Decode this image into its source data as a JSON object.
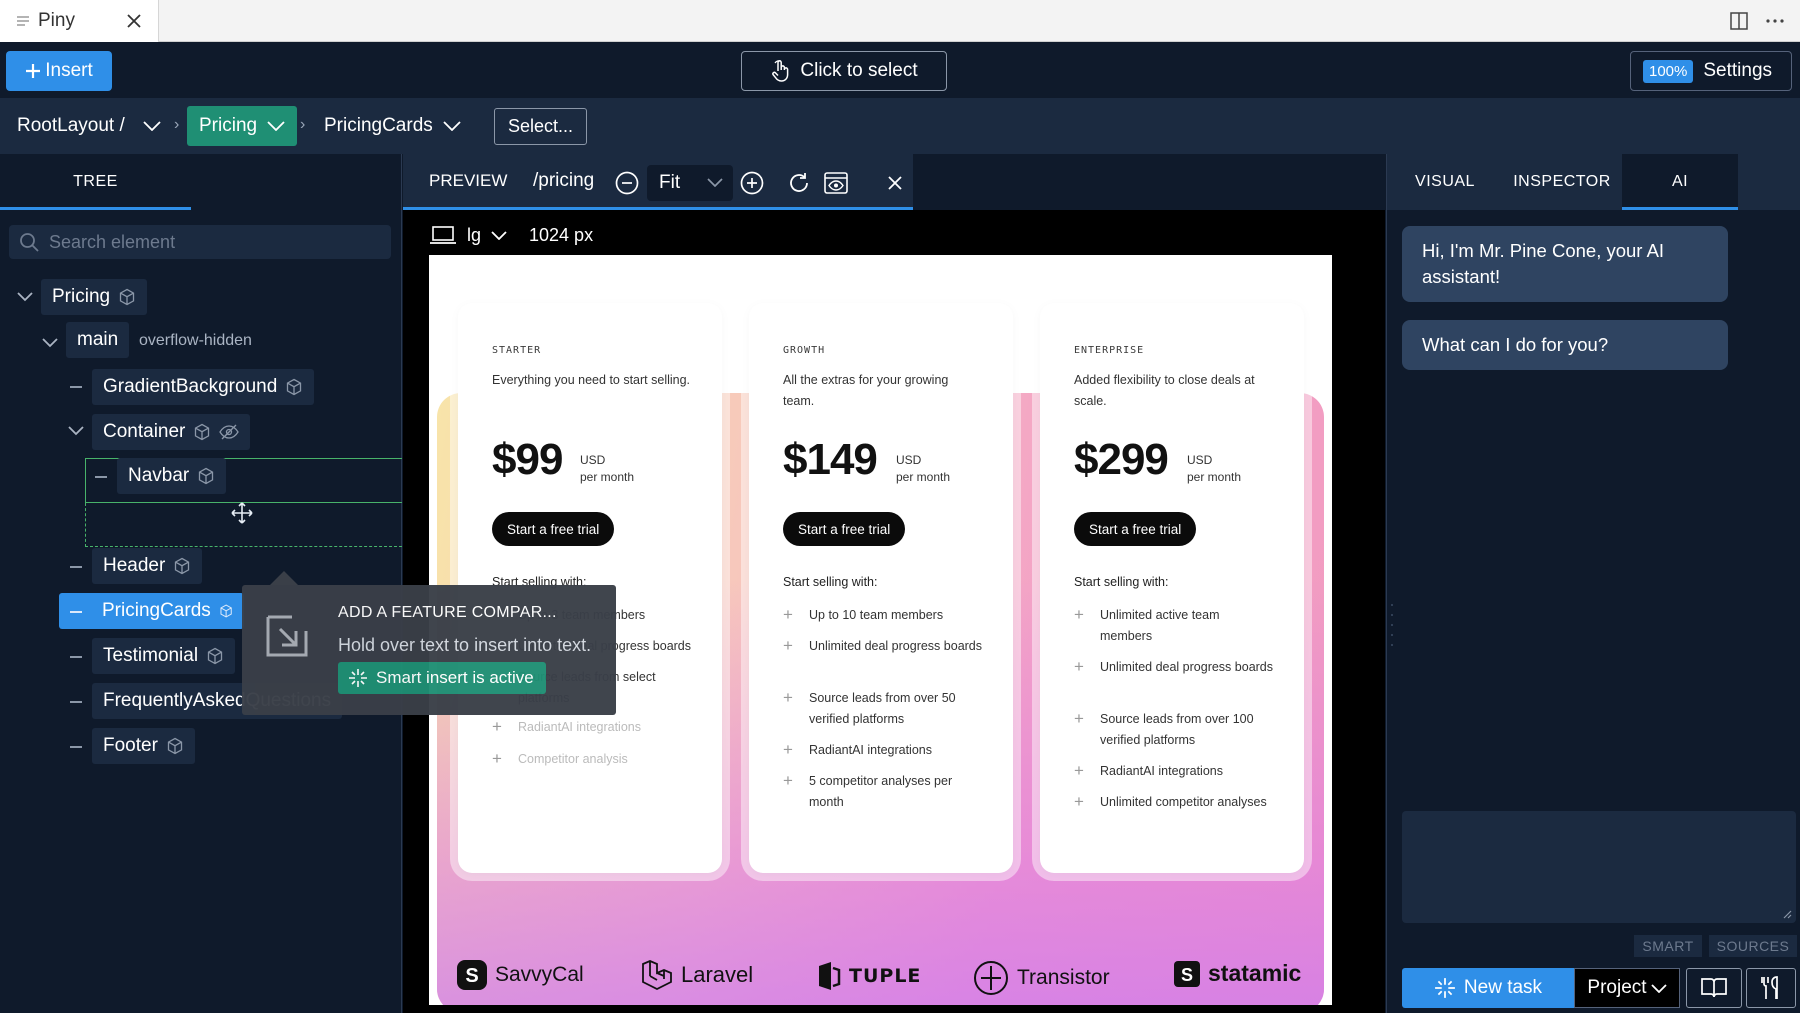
{
  "titlebar": {
    "tab_title": "Piny",
    "doc_icon": "document-icon",
    "close_icon": "close-icon",
    "split_icon": "split-editor-icon",
    "more_icon": "more-icon"
  },
  "toolbar": {
    "insert_label": "Insert",
    "click_select_label": "Click to select",
    "zoom_value": "100%",
    "settings_label": "Settings"
  },
  "breadcrumb": {
    "root": "RootLayout /",
    "active": "Pricing",
    "child": "PricingCards",
    "select_label": "Select..."
  },
  "left": {
    "tab_tree": "TREE",
    "search_placeholder": "Search element",
    "nodes": {
      "pricing": "Pricing",
      "main": "main",
      "main_class": "overflow-hidden",
      "gradient": "GradientBackground",
      "container": "Container",
      "navbar": "Navbar",
      "header": "Header",
      "pricingcards": "PricingCards",
      "testimonial": "Testimonial",
      "faq": "FrequentlyAskedQuestions",
      "footer": "Footer"
    }
  },
  "tooltip": {
    "title": "ADD A FEATURE COMPAR...",
    "subtitle": "Hold over text to insert into text.",
    "badge": "Smart insert is active"
  },
  "preview": {
    "tab_label": "PREVIEW",
    "route": "/pricing",
    "fit_value": "Fit",
    "breakpoint": "lg",
    "width_label": "1024 px"
  },
  "cards": [
    {
      "tier": "STARTER",
      "desc": "Everything you need to start selling.",
      "price": "$99",
      "currency": "USD",
      "period": "per month",
      "cta": "Start a free trial",
      "sub": "Start selling with:",
      "features": [
        "Up to 3 team members",
        "Unlimited deal progress boards",
        "Source leads from select platforms",
        "RadiantAI integrations",
        "Competitor analysis"
      ]
    },
    {
      "tier": "GROWTH",
      "desc": "All the extras for your growing team.",
      "price": "$149",
      "currency": "USD",
      "period": "per month",
      "cta": "Start a free trial",
      "sub": "Start selling with:",
      "features": [
        "Up to 10 team members",
        "Unlimited deal progress boards",
        "Source leads from over 50 verified platforms",
        "RadiantAI integrations",
        "5 competitor analyses per month"
      ]
    },
    {
      "tier": "ENTERPRISE",
      "desc": "Added flexibility to close deals at scale.",
      "price": "$299",
      "currency": "USD",
      "period": "per month",
      "cta": "Start a free trial",
      "sub": "Start selling with:",
      "features": [
        "Unlimited active team members",
        "Unlimited deal progress boards",
        "Source leads from over 100 verified platforms",
        "RadiantAI integrations",
        "Unlimited competitor analyses"
      ]
    }
  ],
  "logos": [
    "SavvyCal",
    "Laravel",
    "TUPLE",
    "Transistor",
    "statamic"
  ],
  "right": {
    "tab_visual": "VISUAL",
    "tab_inspector": "INSPECTOR",
    "tab_ai": "AI",
    "message_1": "Hi, I'm Mr. Pine Cone, your AI assistant!",
    "message_2": "What can I do for you?",
    "pill_smart": "SMART",
    "pill_sources": "SOURCES",
    "new_task": "New task",
    "project": "Project"
  },
  "colors": {
    "accent_blue": "#2f8fe8",
    "accent_green": "#1f8f74",
    "panel_bg": "#0f1a2b",
    "panel_bg_alt": "#1b2a40"
  }
}
